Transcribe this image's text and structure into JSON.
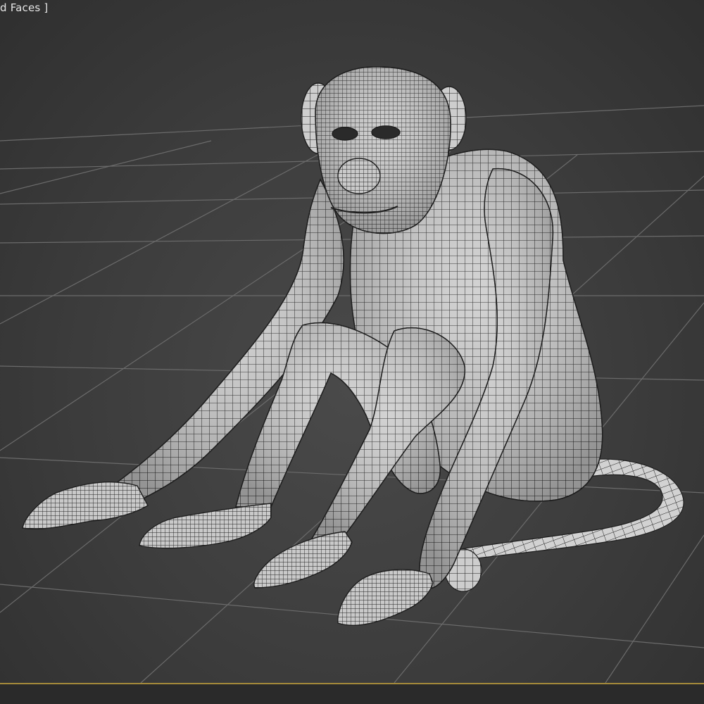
{
  "viewport": {
    "label": "d Faces ]",
    "border_accent": "#a48a3a",
    "background": "#3c3c3c",
    "grid_color": "#6a6a6a",
    "model_color": "#cfcfcf",
    "wire_color": "#1e1e1e"
  },
  "model": {
    "icon": "monkey-wireframe-model"
  }
}
